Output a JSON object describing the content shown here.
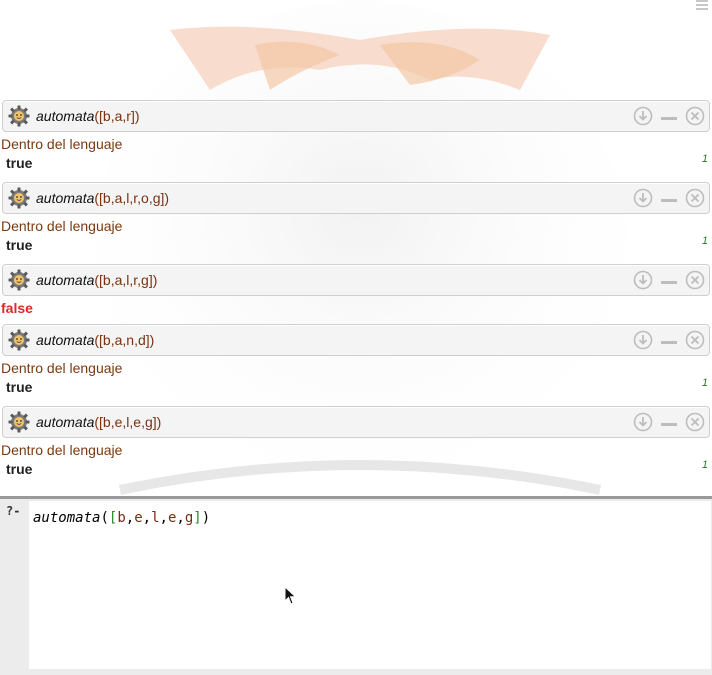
{
  "results": [
    {
      "query_fn": "automata",
      "query_args": "([b,a,r])",
      "output": "Dentro del lenguaje",
      "answer": "true",
      "solution_no": "1"
    },
    {
      "query_fn": "automata",
      "query_args": "([b,a,l,r,o,g])",
      "output": "Dentro del lenguaje",
      "answer": "true",
      "solution_no": "1"
    },
    {
      "query_fn": "automata",
      "query_args": "([b,a,l,r,g])",
      "answer": "false"
    },
    {
      "query_fn": "automata",
      "query_args": "([b,a,n,d])",
      "output": "Dentro del lenguaje",
      "answer": "true",
      "solution_no": "1"
    },
    {
      "query_fn": "automata",
      "query_args": "([b,e,l,e,g])",
      "output": "Dentro del lenguaje",
      "answer": "true",
      "solution_no": "1"
    }
  ],
  "editor": {
    "prompt": "?-",
    "tokens": {
      "fn": "automata",
      "open": "(",
      "bracket_open": "[",
      "a1": "b",
      "c1": ",",
      "a2": "e",
      "c2": ",",
      "a3": "l",
      "c3": ",",
      "a4": "e",
      "c4": ",",
      "a5": "g",
      "bracket_close": "]",
      "close": ")"
    }
  },
  "icons": {
    "query": "gear-icon",
    "download": "download-icon",
    "minimize": "minimize-icon",
    "close": "close-icon",
    "menu": "hamburger-menu-icon"
  },
  "colors": {
    "output_text": "#7a3a10",
    "false_text": "#e02828",
    "solution_number": "#2a7a2a"
  }
}
